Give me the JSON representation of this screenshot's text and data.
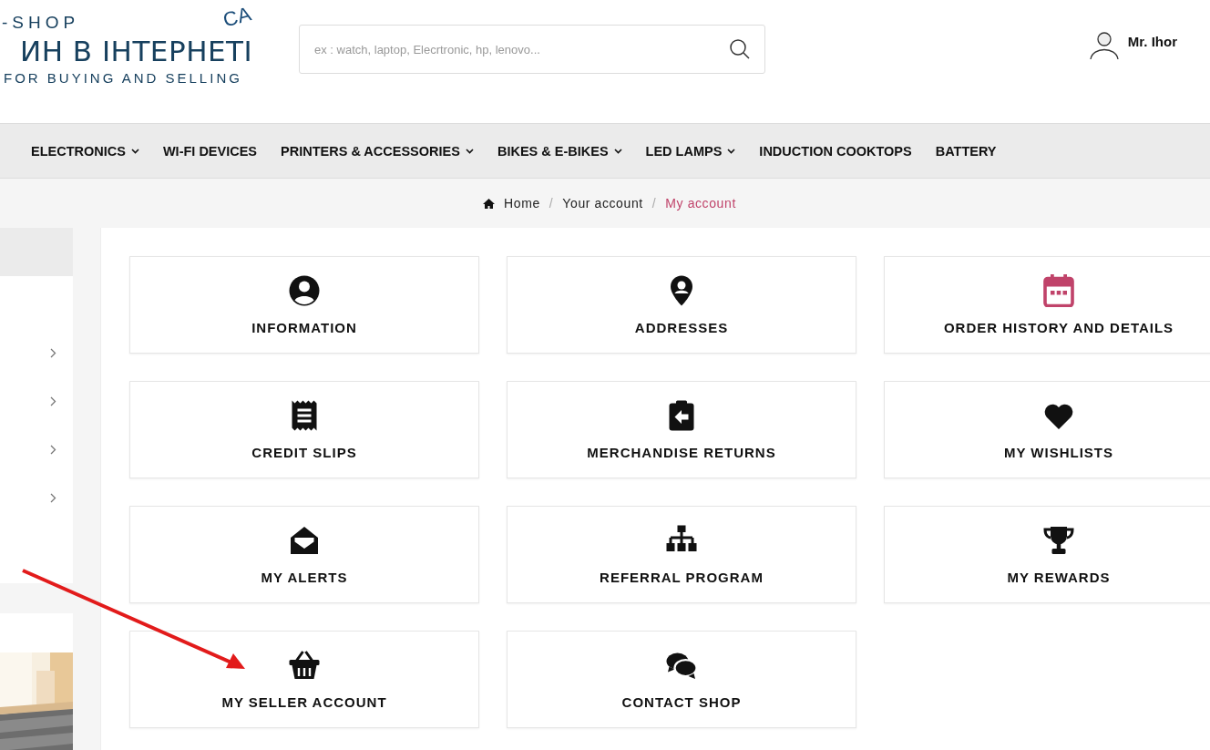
{
  "logo": {
    "top": "-SHOP",
    "main": "ИН В ІНТЕРНЕТІ",
    "tagline": "FOR BUYING AND SELLING",
    "badge": "CA"
  },
  "search": {
    "placeholder": "ex : watch, laptop, Elecrtronic, hp, lenovo..."
  },
  "user": {
    "name": "Mr. Ihor"
  },
  "nav": [
    {
      "label": "ELECTRONICS",
      "has_dropdown": true
    },
    {
      "label": "WI-FI DEVICES",
      "has_dropdown": false
    },
    {
      "label": "PRINTERS & ACCESSORIES",
      "has_dropdown": true
    },
    {
      "label": "BIKES & E-BIKES",
      "has_dropdown": true
    },
    {
      "label": "LED LAMPS",
      "has_dropdown": true
    },
    {
      "label": "INDUCTION COOKTOPS",
      "has_dropdown": false
    },
    {
      "label": "BATTERY",
      "has_dropdown": false
    }
  ],
  "breadcrumb": [
    {
      "label": "Home",
      "selected": false
    },
    {
      "separator": "/",
      "label": "Your account",
      "selected": false
    },
    {
      "separator": "/",
      "label": "My account",
      "selected": true
    }
  ],
  "sidebar": {
    "items": [
      {
        "kind": "category"
      },
      {
        "kind": "category"
      },
      {
        "kind": "category"
      },
      {
        "kind": "category"
      }
    ]
  },
  "tiles": [
    {
      "label": "INFORMATION",
      "color": "#111111"
    },
    {
      "label": "ADDRESSES",
      "color": "#111111"
    },
    {
      "label": "ORDER HISTORY AND DETAILS",
      "color": "#c0436a"
    },
    {
      "label": "CREDIT SLIPS",
      "color": "#111111"
    },
    {
      "label": "MERCHANDISE RETURNS",
      "color": "#111111"
    },
    {
      "label": "MY WISHLISTS",
      "color": "#111111"
    },
    {
      "label": "MY ALERTS",
      "color": "#111111"
    },
    {
      "label": "REFERRAL PROGRAM",
      "color": "#111111"
    },
    {
      "label": "MY REWARDS",
      "color": "#111111"
    },
    {
      "label": "MY SELLER ACCOUNT",
      "color": "#111111"
    },
    {
      "label": "CONTACT SHOP",
      "color": "#111111"
    }
  ]
}
